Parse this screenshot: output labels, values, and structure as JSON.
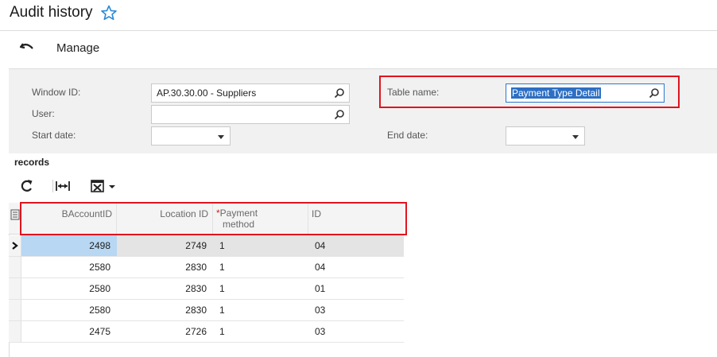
{
  "header": {
    "title": "Audit history"
  },
  "toolbar": {
    "manage_label": "Manage"
  },
  "filters": {
    "window_id": {
      "label": "Window ID:",
      "value": "AP.30.30.00 - Suppliers"
    },
    "user": {
      "label": "User:",
      "value": ""
    },
    "start_date": {
      "label": "Start date:",
      "value": ""
    },
    "table_name": {
      "label": "Table name:",
      "value": "Payment Type Detail"
    },
    "end_date": {
      "label": "End date:",
      "value": ""
    }
  },
  "records": {
    "label": "records",
    "columns": {
      "baccountid": "BAccountID",
      "location_id": "Location ID",
      "payment_method_star": "*",
      "payment_method_line1": "Payment",
      "payment_method_line2": "method",
      "id": "ID"
    },
    "rows": [
      {
        "baccountid": "2498",
        "location_id": "2749",
        "payment_method": "1",
        "id": "04"
      },
      {
        "baccountid": "2580",
        "location_id": "2830",
        "payment_method": "1",
        "id": "04"
      },
      {
        "baccountid": "2580",
        "location_id": "2830",
        "payment_method": "1",
        "id": "01"
      },
      {
        "baccountid": "2580",
        "location_id": "2830",
        "payment_method": "1",
        "id": "03"
      },
      {
        "baccountid": "2475",
        "location_id": "2726",
        "payment_method": "1",
        "id": "03"
      }
    ]
  },
  "colors": {
    "highlight": "#e0141e",
    "selected_row": "#b7d7f2",
    "accent": "#2d6fc4",
    "star": "#2a8ad8"
  }
}
